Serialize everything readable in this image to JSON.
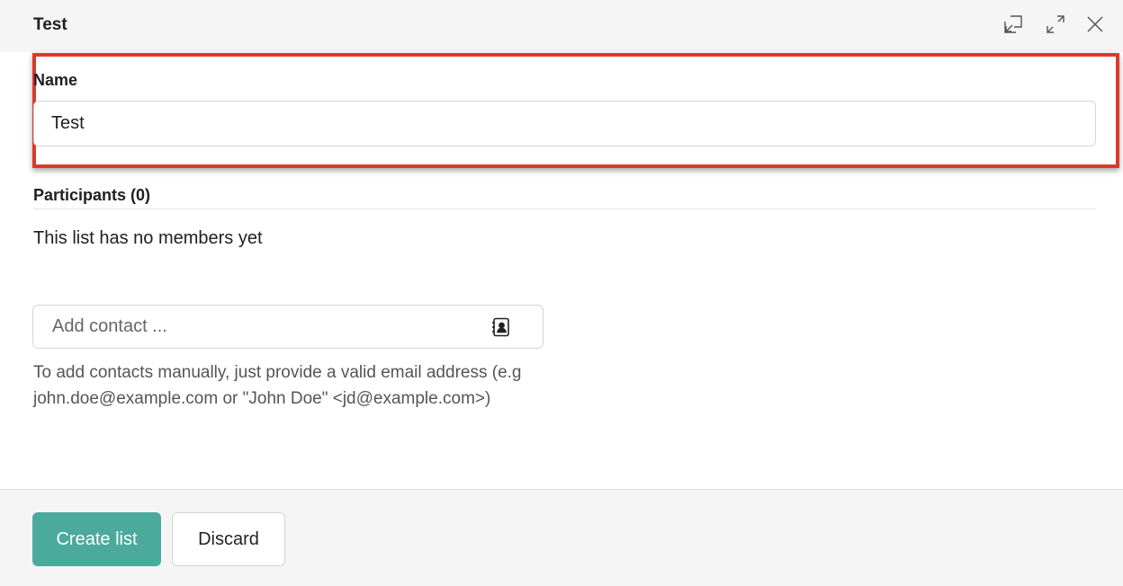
{
  "header": {
    "title": "Test",
    "icons": [
      "minimize-to-corner-icon",
      "expand-icon",
      "close-icon"
    ]
  },
  "form": {
    "name_label": "Name",
    "name_value": "Test",
    "participants_label": "Participants (0)",
    "empty_message": "This list has no members yet",
    "contact_placeholder": "Add contact ...",
    "contact_icon": "address-book-icon",
    "help_text": "To add contacts manually, just provide a valid email address (e.g john.doe@example.com or \"John Doe\" <jd@example.com>)"
  },
  "footer": {
    "create_label": "Create list",
    "discard_label": "Discard"
  },
  "colors": {
    "accent": "#4aaa9d",
    "highlight": "#d93a2b"
  }
}
